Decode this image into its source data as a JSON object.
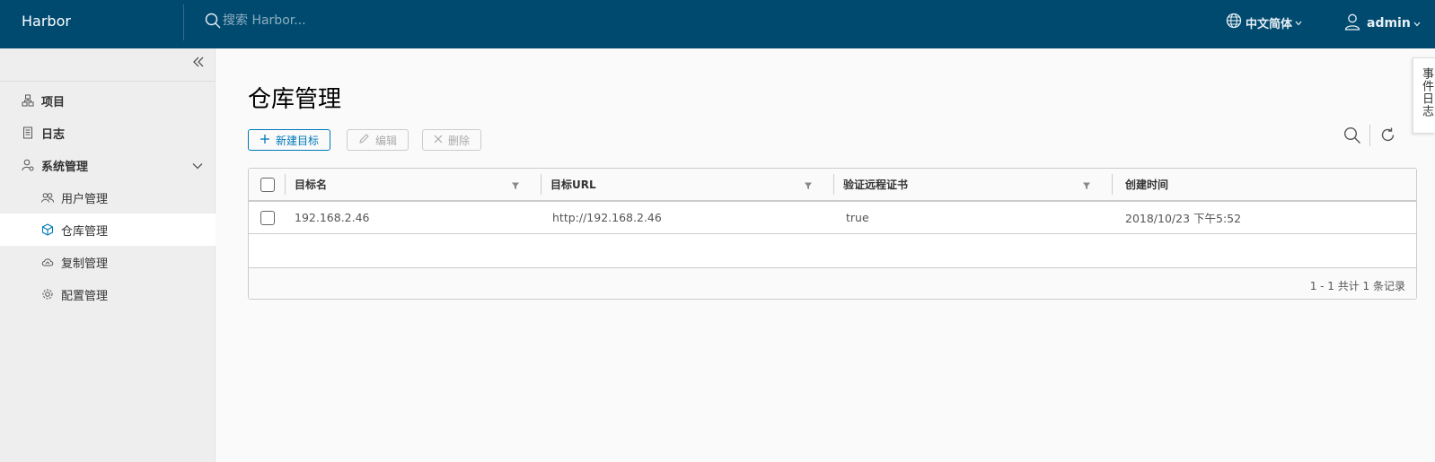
{
  "header": {
    "brand": "Harbor",
    "search_placeholder": "搜索 Harbor...",
    "language": "中文简体",
    "username": "admin"
  },
  "sidebar": {
    "items": [
      {
        "label": "项目",
        "icon": "projects-icon"
      },
      {
        "label": "日志",
        "icon": "logs-icon"
      },
      {
        "label": "系统管理",
        "icon": "admin-icon",
        "expanded": true
      },
      {
        "label": "用户管理",
        "icon": "users-icon"
      },
      {
        "label": "仓库管理",
        "icon": "registry-icon",
        "active": true
      },
      {
        "label": "复制管理",
        "icon": "replication-cloud-icon"
      },
      {
        "label": "配置管理",
        "icon": "config-gear-icon"
      }
    ]
  },
  "main": {
    "title": "仓库管理",
    "toolbar": {
      "new_label": "新建目标",
      "edit_label": "编辑",
      "delete_label": "删除"
    },
    "table": {
      "columns": [
        "目标名",
        "目标URL",
        "验证远程证书",
        "创建时间"
      ],
      "rows": [
        [
          "192.168.2.46",
          "http://192.168.2.46",
          "true",
          "2018/10/23 下午5:52"
        ]
      ],
      "footer": "1 - 1 共计 1 条记录"
    }
  },
  "event_tab": "事件日志",
  "colors": {
    "header_bg": "#004a70",
    "accent": "#0079b8",
    "sidebar_bg": "#eeeeee"
  }
}
